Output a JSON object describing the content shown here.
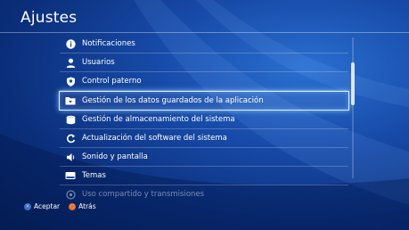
{
  "header": {
    "title": "Ajustes"
  },
  "menu": {
    "items": [
      {
        "label": "Notificaciones",
        "icon": "info-icon"
      },
      {
        "label": "Usuarios",
        "icon": "user-icon"
      },
      {
        "label": "Control paterno",
        "icon": "parental-control-icon"
      },
      {
        "label": "Gestión de los datos guardados de la aplicación",
        "icon": "saved-data-folder-icon",
        "selected": true
      },
      {
        "label": "Gestión de almacenamiento del sistema",
        "icon": "storage-icon"
      },
      {
        "label": "Actualización del software del sistema",
        "icon": "update-icon"
      },
      {
        "label": "Sonido y pantalla",
        "icon": "sound-icon"
      },
      {
        "label": "Temas",
        "icon": "themes-icon"
      },
      {
        "label": "Uso compartido y transmisiones",
        "icon": "share-icon"
      }
    ]
  },
  "footer": {
    "accept_label": "Aceptar",
    "back_label": "Atrás"
  },
  "colors": {
    "accent_cross": "#3b6fc6",
    "accent_circle": "#e36a27"
  }
}
